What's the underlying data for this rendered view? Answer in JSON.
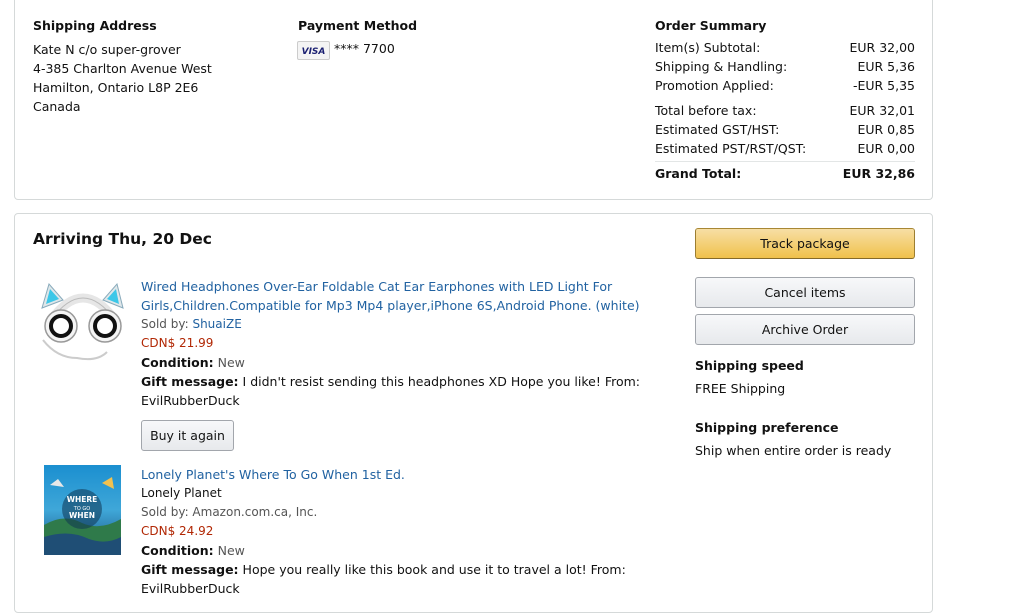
{
  "shipping_address": {
    "heading": "Shipping Address",
    "lines": [
      "Kate N c/o super-grover",
      "4-385 Charlton Avenue West",
      "Hamilton, Ontario L8P 2E6",
      "Canada"
    ]
  },
  "payment_method": {
    "heading": "Payment Method",
    "card_brand": "VISA",
    "card_number": "**** 7700"
  },
  "order_summary": {
    "heading": "Order Summary",
    "rows": [
      {
        "label": "Item(s) Subtotal:",
        "value": "EUR 32,00"
      },
      {
        "label": "Shipping & Handling:",
        "value": "EUR 5,36"
      },
      {
        "label": "Promotion Applied:",
        "value": "-EUR 5,35"
      },
      {
        "label": "Total before tax:",
        "value": "EUR 32,01"
      },
      {
        "label": "Estimated GST/HST:",
        "value": "EUR 0,85"
      },
      {
        "label": "Estimated PST/RST/QST:",
        "value": "EUR 0,00"
      }
    ],
    "grand_total_label": "Grand Total:",
    "grand_total_value": "EUR 32,86"
  },
  "shipment": {
    "arriving": "Arriving Thu, 20 Dec",
    "items": [
      {
        "title_line1": "Wired Headphones Over-Ear Foldable Cat Ear Earphones with LED Light For",
        "title_line2": "Girls,Children.Compatible for Mp3 Mp4 player,iPhone 6S,Android Phone. (white)",
        "sold_by_label": "Sold by:",
        "sold_by": "ShuaiZE",
        "price": "CDN$ 21.99",
        "condition_label": "Condition:",
        "condition": "New",
        "gift_label": "Gift message:",
        "gift_text": "I didn't resist sending this headphones XD Hope you like! From:",
        "gift_from": "EvilRubberDuck",
        "buy_again": "Buy it again"
      },
      {
        "title": "Lonely Planet's Where To Go When 1st Ed.",
        "author": "Lonely Planet",
        "sold_by_text": "Sold by: Amazon.com.ca, Inc.",
        "price": "CDN$ 24.92",
        "condition_label": "Condition:",
        "condition": "New",
        "gift_label": "Gift message:",
        "gift_text": "Hope you really like this book and use it to travel a lot! From:",
        "gift_from": "EvilRubberDuck",
        "cover_text_1": "WHERE",
        "cover_text_2": "TO GO",
        "cover_text_3": "WHEN"
      }
    ],
    "actions": {
      "track": "Track package",
      "cancel": "Cancel items",
      "archive": "Archive Order"
    },
    "shipping_speed_heading": "Shipping speed",
    "shipping_speed": "FREE Shipping",
    "shipping_pref_heading": "Shipping preference",
    "shipping_pref": "Ship when entire order is ready"
  }
}
